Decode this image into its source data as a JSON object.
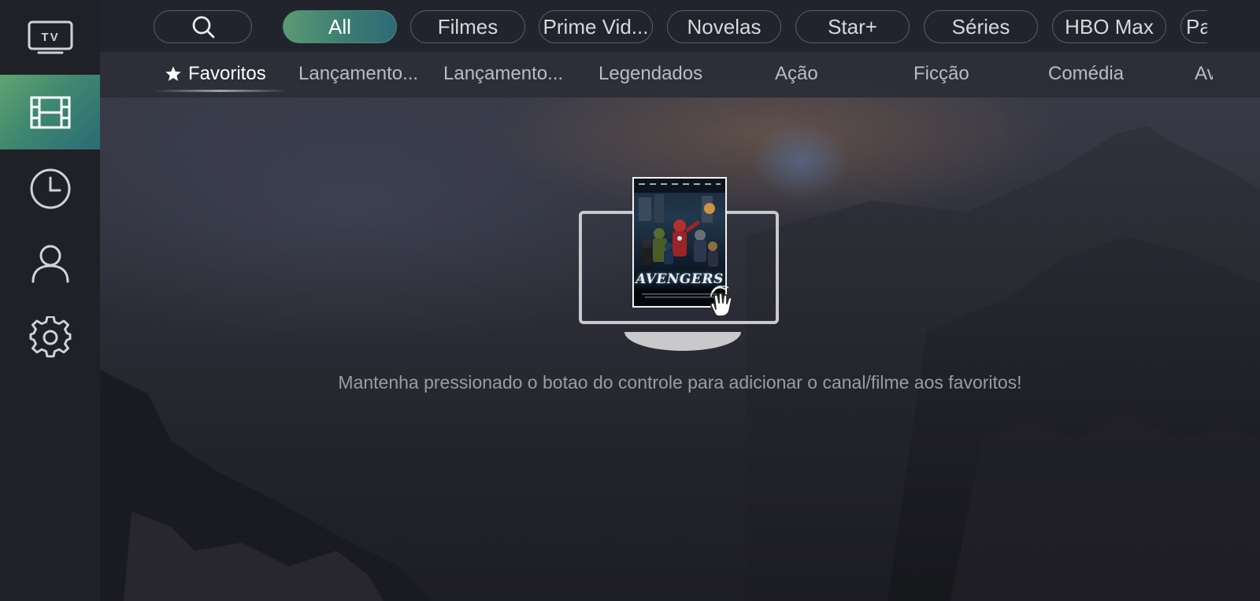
{
  "colors": {
    "accent_gradient_start": "#5fa470",
    "accent_gradient_end": "#2a6b75",
    "sidebar_bg": "#1f2127",
    "text_muted": "#9a9ca3"
  },
  "sidebar": {
    "items": [
      {
        "icon": "tv-icon",
        "label": "TV",
        "active": false
      },
      {
        "icon": "film-icon",
        "active": true
      },
      {
        "icon": "clock-icon",
        "active": false
      },
      {
        "icon": "user-icon",
        "active": false
      },
      {
        "icon": "gear-icon",
        "active": false
      }
    ]
  },
  "filters": {
    "search_icon": "search-icon",
    "pills": [
      {
        "label": "All",
        "active": true
      },
      {
        "label": "Filmes",
        "active": false
      },
      {
        "label": "Prime Vid...",
        "active": false
      },
      {
        "label": "Novelas",
        "active": false
      },
      {
        "label": "Star+",
        "active": false
      },
      {
        "label": "Séries",
        "active": false
      },
      {
        "label": "HBO Max",
        "active": false
      },
      {
        "label": "Pa",
        "active": false
      }
    ]
  },
  "categories": {
    "star_icon": "star-icon",
    "items": [
      {
        "label": "Favoritos",
        "active": true
      },
      {
        "label": "Lançamento..."
      },
      {
        "label": "Lançamento..."
      },
      {
        "label": "Legendados"
      },
      {
        "label": "Ação"
      },
      {
        "label": "Ficção"
      },
      {
        "label": "Comédia"
      },
      {
        "label": "Av"
      }
    ]
  },
  "empty_state": {
    "poster_title": "AVENGERS",
    "hand_icon": "tap-hand-icon",
    "message": "Mantenha pressionado o botao do controle para adicionar o canal/filme aos favoritos!"
  }
}
